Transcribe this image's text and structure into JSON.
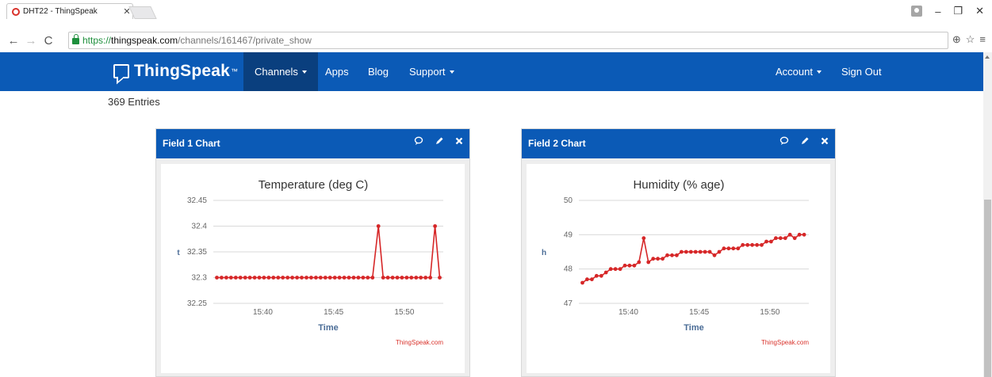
{
  "browser": {
    "tab_title": "DHT22 - ThingSpeak",
    "url_scheme": "https://",
    "url_host": "thingspeak.com",
    "url_path": "/channels/161467/private_show"
  },
  "nav": {
    "logo": "ThingSpeak",
    "logo_tm": "™",
    "channels": "Channels",
    "apps": "Apps",
    "blog": "Blog",
    "support": "Support",
    "account": "Account",
    "sign_out": "Sign Out"
  },
  "entries_label": "369 Entries",
  "cards": [
    {
      "header": "Field 1 Chart"
    },
    {
      "header": "Field 2 Chart"
    }
  ],
  "chart_data": [
    {
      "type": "line",
      "title": "Temperature (deg C)",
      "xlabel": "Time",
      "ylabel": "t",
      "credit": "ThingSpeak.com",
      "color": "#d62728",
      "ylim": [
        32.25,
        32.45
      ],
      "yticks": [
        32.25,
        32.3,
        32.35,
        32.4,
        32.45
      ],
      "ytick_labels": [
        "32.25",
        "32.3",
        "32.35",
        "32.4",
        "32.45"
      ],
      "xticks": [
        "15:40",
        "15:45",
        "15:50"
      ],
      "xlim": [
        "15:36:30",
        "15:52:45"
      ],
      "x": [
        "15:36:45",
        "15:37:05",
        "15:37:25",
        "15:37:45",
        "15:38:05",
        "15:38:25",
        "15:38:45",
        "15:39:05",
        "15:39:25",
        "15:39:45",
        "15:40:05",
        "15:40:25",
        "15:40:45",
        "15:41:05",
        "15:41:25",
        "15:41:45",
        "15:42:05",
        "15:42:25",
        "15:42:45",
        "15:43:05",
        "15:43:25",
        "15:43:45",
        "15:44:05",
        "15:44:25",
        "15:44:45",
        "15:45:05",
        "15:45:25",
        "15:45:45",
        "15:46:05",
        "15:46:25",
        "15:46:45",
        "15:47:05",
        "15:47:25",
        "15:47:45",
        "15:48:10",
        "15:48:30",
        "15:48:50",
        "15:49:10",
        "15:49:30",
        "15:49:50",
        "15:50:10",
        "15:50:30",
        "15:50:50",
        "15:51:10",
        "15:51:30",
        "15:51:50",
        "15:52:10",
        "15:52:30"
      ],
      "y": [
        32.3,
        32.3,
        32.3,
        32.3,
        32.3,
        32.3,
        32.3,
        32.3,
        32.3,
        32.3,
        32.3,
        32.3,
        32.3,
        32.3,
        32.3,
        32.3,
        32.3,
        32.3,
        32.3,
        32.3,
        32.3,
        32.3,
        32.3,
        32.3,
        32.3,
        32.3,
        32.3,
        32.3,
        32.3,
        32.3,
        32.3,
        32.3,
        32.3,
        32.3,
        32.4,
        32.3,
        32.3,
        32.3,
        32.3,
        32.3,
        32.3,
        32.3,
        32.3,
        32.3,
        32.3,
        32.3,
        32.4,
        32.3
      ]
    },
    {
      "type": "line",
      "title": "Humidity (% age)",
      "xlabel": "Time",
      "ylabel": "h",
      "credit": "ThingSpeak.com",
      "color": "#d62728",
      "ylim": [
        47,
        50
      ],
      "yticks": [
        47,
        48,
        49,
        50
      ],
      "ytick_labels": [
        "47",
        "48",
        "49",
        "50"
      ],
      "xticks": [
        "15:40",
        "15:45",
        "15:50"
      ],
      "xlim": [
        "15:36:30",
        "15:52:45"
      ],
      "x": [
        "15:36:45",
        "15:37:05",
        "15:37:25",
        "15:37:45",
        "15:38:05",
        "15:38:25",
        "15:38:45",
        "15:39:05",
        "15:39:25",
        "15:39:45",
        "15:40:05",
        "15:40:25",
        "15:40:45",
        "15:41:05",
        "15:41:25",
        "15:41:45",
        "15:42:05",
        "15:42:25",
        "15:42:45",
        "15:43:05",
        "15:43:25",
        "15:43:45",
        "15:44:05",
        "15:44:25",
        "15:44:45",
        "15:45:05",
        "15:45:25",
        "15:45:45",
        "15:46:05",
        "15:46:25",
        "15:46:45",
        "15:47:05",
        "15:47:25",
        "15:47:45",
        "15:48:05",
        "15:48:25",
        "15:48:45",
        "15:49:05",
        "15:49:25",
        "15:49:45",
        "15:50:05",
        "15:50:25",
        "15:50:45",
        "15:51:05",
        "15:51:25",
        "15:51:45",
        "15:52:05",
        "15:52:25"
      ],
      "y": [
        47.6,
        47.7,
        47.7,
        47.8,
        47.8,
        47.9,
        48.0,
        48.0,
        48.0,
        48.1,
        48.1,
        48.1,
        48.2,
        48.9,
        48.2,
        48.3,
        48.3,
        48.3,
        48.4,
        48.4,
        48.4,
        48.5,
        48.5,
        48.5,
        48.5,
        48.5,
        48.5,
        48.5,
        48.4,
        48.5,
        48.6,
        48.6,
        48.6,
        48.6,
        48.7,
        48.7,
        48.7,
        48.7,
        48.7,
        48.8,
        48.8,
        48.9,
        48.9,
        48.9,
        49.0,
        48.9,
        49.0,
        49.0
      ]
    }
  ]
}
